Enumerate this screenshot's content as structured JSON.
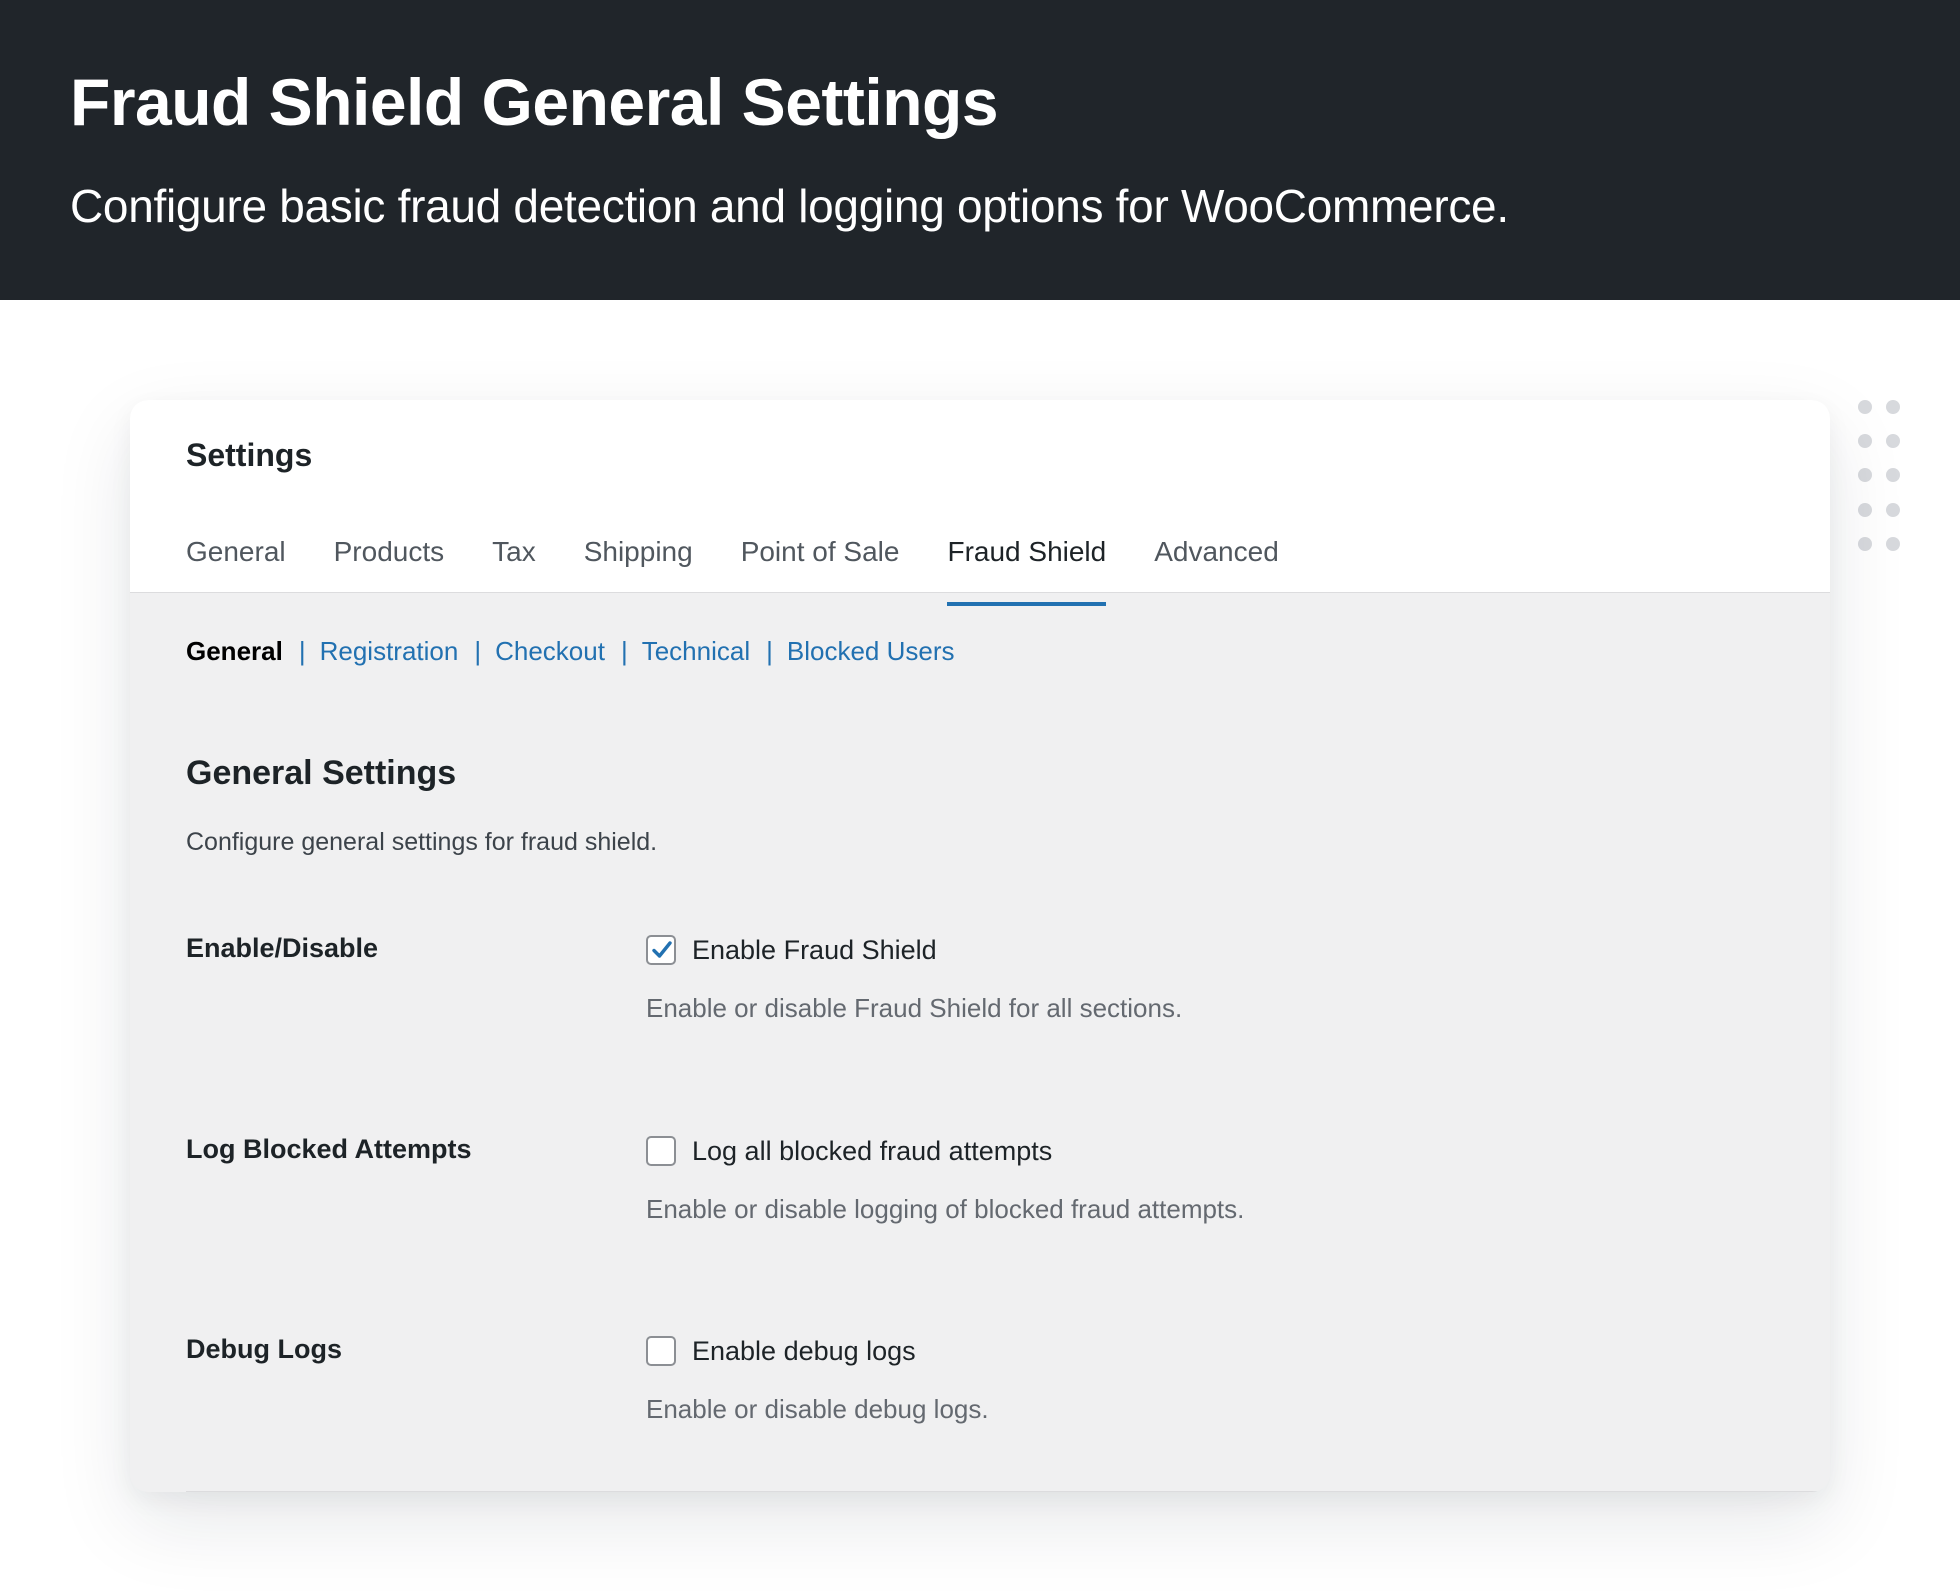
{
  "hero": {
    "title": "Fraud Shield General Settings",
    "subtitle": "Configure basic fraud detection and logging options for WooCommerce."
  },
  "settings": {
    "title": "Settings",
    "tabs": [
      {
        "label": "General",
        "active": false
      },
      {
        "label": "Products",
        "active": false
      },
      {
        "label": "Tax",
        "active": false
      },
      {
        "label": "Shipping",
        "active": false
      },
      {
        "label": "Point of Sale",
        "active": false
      },
      {
        "label": "Fraud Shield",
        "active": true
      },
      {
        "label": "Advanced",
        "active": false
      }
    ],
    "subnav": {
      "current": "General",
      "separator": "|",
      "links": [
        "Registration",
        "Checkout",
        "Technical",
        "Blocked Users"
      ]
    },
    "section": {
      "title": "General Settings",
      "description": "Configure general settings for fraud shield."
    },
    "fields": [
      {
        "label": "Enable/Disable",
        "checkbox_label": "Enable Fraud Shield",
        "checked": true,
        "help": "Enable or disable Fraud Shield for all sections."
      },
      {
        "label": "Log Blocked Attempts",
        "checkbox_label": "Log all blocked fraud attempts",
        "checked": false,
        "help": "Enable or disable logging of blocked fraud attempts."
      },
      {
        "label": "Debug Logs",
        "checkbox_label": "Enable debug logs",
        "checked": false,
        "help": "Enable or disable debug logs."
      }
    ]
  },
  "colors": {
    "hero_bg": "#20252a",
    "accent": "#2271b1",
    "panel_bg": "#f0f0f1"
  },
  "icons": {
    "checkmark": "check-icon",
    "decoration": "dot-grid-icon"
  }
}
